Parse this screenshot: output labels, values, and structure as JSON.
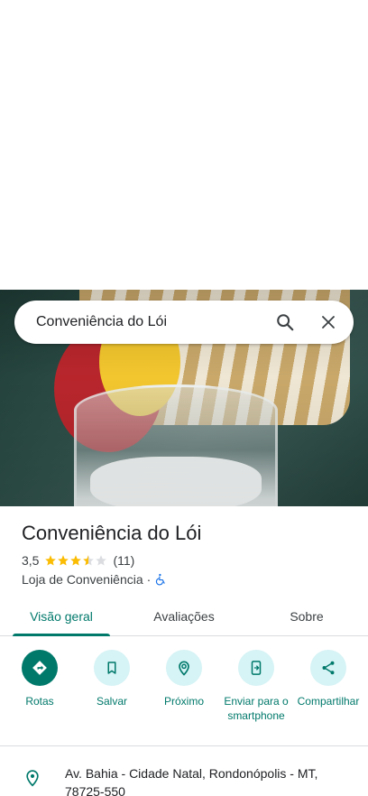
{
  "search": {
    "query": "Conveniência do Lói"
  },
  "place": {
    "name": "Conveniência do Lói",
    "rating": "3,5",
    "rating_value": 3.5,
    "review_count": "(11)",
    "category": "Loja de Conveniência",
    "separator": "·"
  },
  "tabs": [
    {
      "label": "Visão geral",
      "active": true
    },
    {
      "label": "Avaliações",
      "active": false
    },
    {
      "label": "Sobre",
      "active": false
    }
  ],
  "actions": [
    {
      "label": "Rotas",
      "icon": "directions-icon"
    },
    {
      "label": "Salvar",
      "icon": "bookmark-icon"
    },
    {
      "label": "Próximo",
      "icon": "nearby-icon"
    },
    {
      "label": "Enviar para o smartphone",
      "icon": "send-to-phone-icon"
    },
    {
      "label": "Compartilhar",
      "icon": "share-icon"
    }
  ],
  "address": {
    "text": "Av. Bahia - Cidade Natal, Rondonópolis - MT, 78725-550"
  },
  "colors": {
    "accent": "#00796b",
    "action_bg": "#d6f3f5",
    "star": "#fbbc04",
    "accessible_icon": "#1a73e8"
  }
}
